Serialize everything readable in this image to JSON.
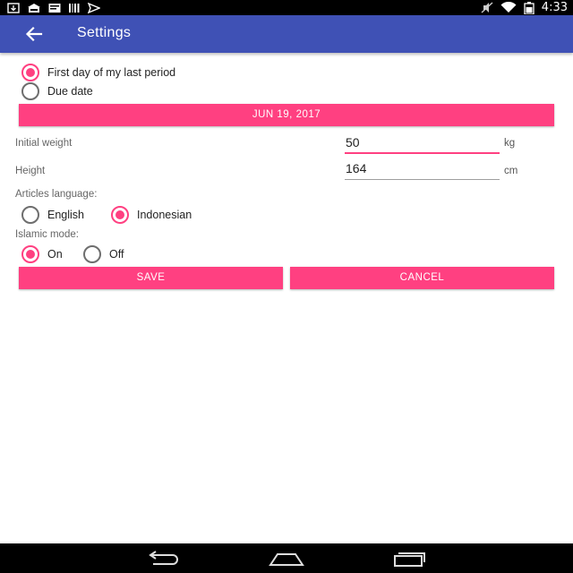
{
  "status_bar": {
    "time": "4:33",
    "left_icons": [
      "download-icon",
      "store-icon",
      "message-icon",
      "barcode-icon",
      "send-icon"
    ],
    "right_icons": [
      "mute-icon",
      "wifi-icon",
      "battery-icon"
    ]
  },
  "toolbar": {
    "title": "Settings",
    "color": "#3f51b5"
  },
  "date_mode": {
    "options": [
      {
        "label": "First day of my last period",
        "checked": true
      },
      {
        "label": "Due date",
        "checked": false
      }
    ]
  },
  "date_button": {
    "label": "JUN 19, 2017"
  },
  "weight": {
    "label": "Initial weight",
    "value": "50",
    "unit": "kg"
  },
  "height": {
    "label": "Height",
    "value": "164",
    "unit": "cm"
  },
  "articles_language": {
    "label": "Articles language:",
    "options": [
      {
        "label": "English",
        "checked": false
      },
      {
        "label": "Indonesian",
        "checked": true
      }
    ]
  },
  "islamic_mode": {
    "label": "Islamic mode:",
    "options": [
      {
        "label": "On",
        "checked": true
      },
      {
        "label": "Off",
        "checked": false
      }
    ]
  },
  "actions": {
    "save_label": "SAVE",
    "cancel_label": "CANCEL"
  },
  "accent_color": "#ff4081",
  "nav_bar": {
    "buttons": [
      "back-nav-icon",
      "home-nav-icon",
      "recents-nav-icon"
    ]
  }
}
